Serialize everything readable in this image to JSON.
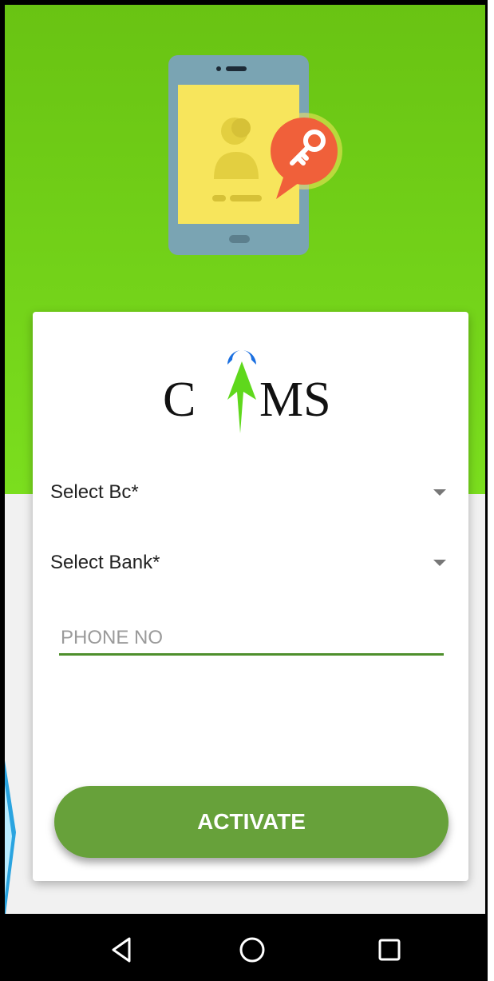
{
  "form": {
    "bc_select_label": "Select Bc*",
    "bank_select_label": "Select Bank*",
    "phone_placeholder": "PHONE NO",
    "phone_value": "",
    "activate_label": "ACTIVATE"
  },
  "logo": {
    "text_left": "C",
    "text_right": "MS"
  },
  "nav": {
    "back": "back-icon",
    "home": "home-icon",
    "recents": "recents-icon"
  },
  "colors": {
    "hero_green": "#6fcc16",
    "button_green": "#67a13a",
    "underline_green": "#4e8f2c",
    "logo_blue": "#1a6fe0",
    "logo_green": "#5fd81c",
    "key_badge": "#f0603a"
  }
}
